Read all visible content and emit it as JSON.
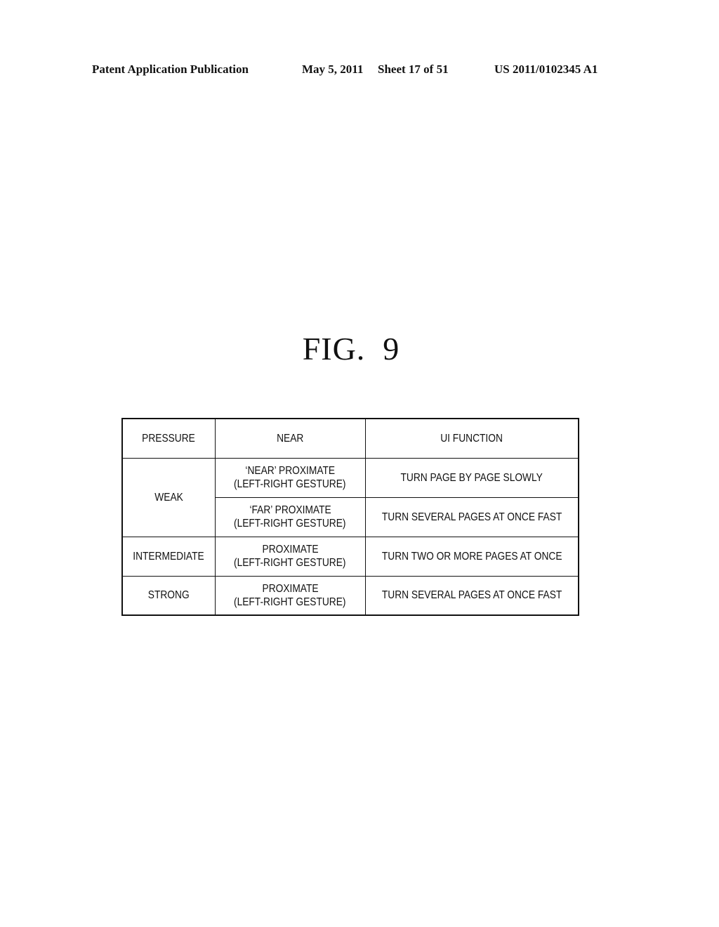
{
  "header": {
    "publication": "Patent Application Publication",
    "date": "May 5, 2011",
    "sheet": "Sheet 17 of 51",
    "number": "US 2011/0102345 A1"
  },
  "figure": {
    "title": "FIG.  9"
  },
  "table": {
    "columns": [
      "PRESSURE",
      "NEAR",
      "UI FUNCTION"
    ],
    "rows": [
      {
        "pressure": "WEAK",
        "near_line1": "‘NEAR’ PROXIMATE",
        "near_line2": "(LEFT-RIGHT GESTURE)",
        "function": "TURN PAGE BY PAGE SLOWLY"
      },
      {
        "pressure": "WEAK",
        "near_line1": "‘FAR’ PROXIMATE",
        "near_line2": "(LEFT-RIGHT GESTURE)",
        "function": "TURN SEVERAL PAGES AT ONCE FAST"
      },
      {
        "pressure": "INTERMEDIATE",
        "near_line1": "PROXIMATE",
        "near_line2": "(LEFT-RIGHT GESTURE)",
        "function": "TURN TWO OR MORE PAGES AT ONCE"
      },
      {
        "pressure": "STRONG",
        "near_line1": "PROXIMATE",
        "near_line2": "(LEFT-RIGHT GESTURE)",
        "function": "TURN SEVERAL PAGES AT ONCE FAST"
      }
    ]
  }
}
